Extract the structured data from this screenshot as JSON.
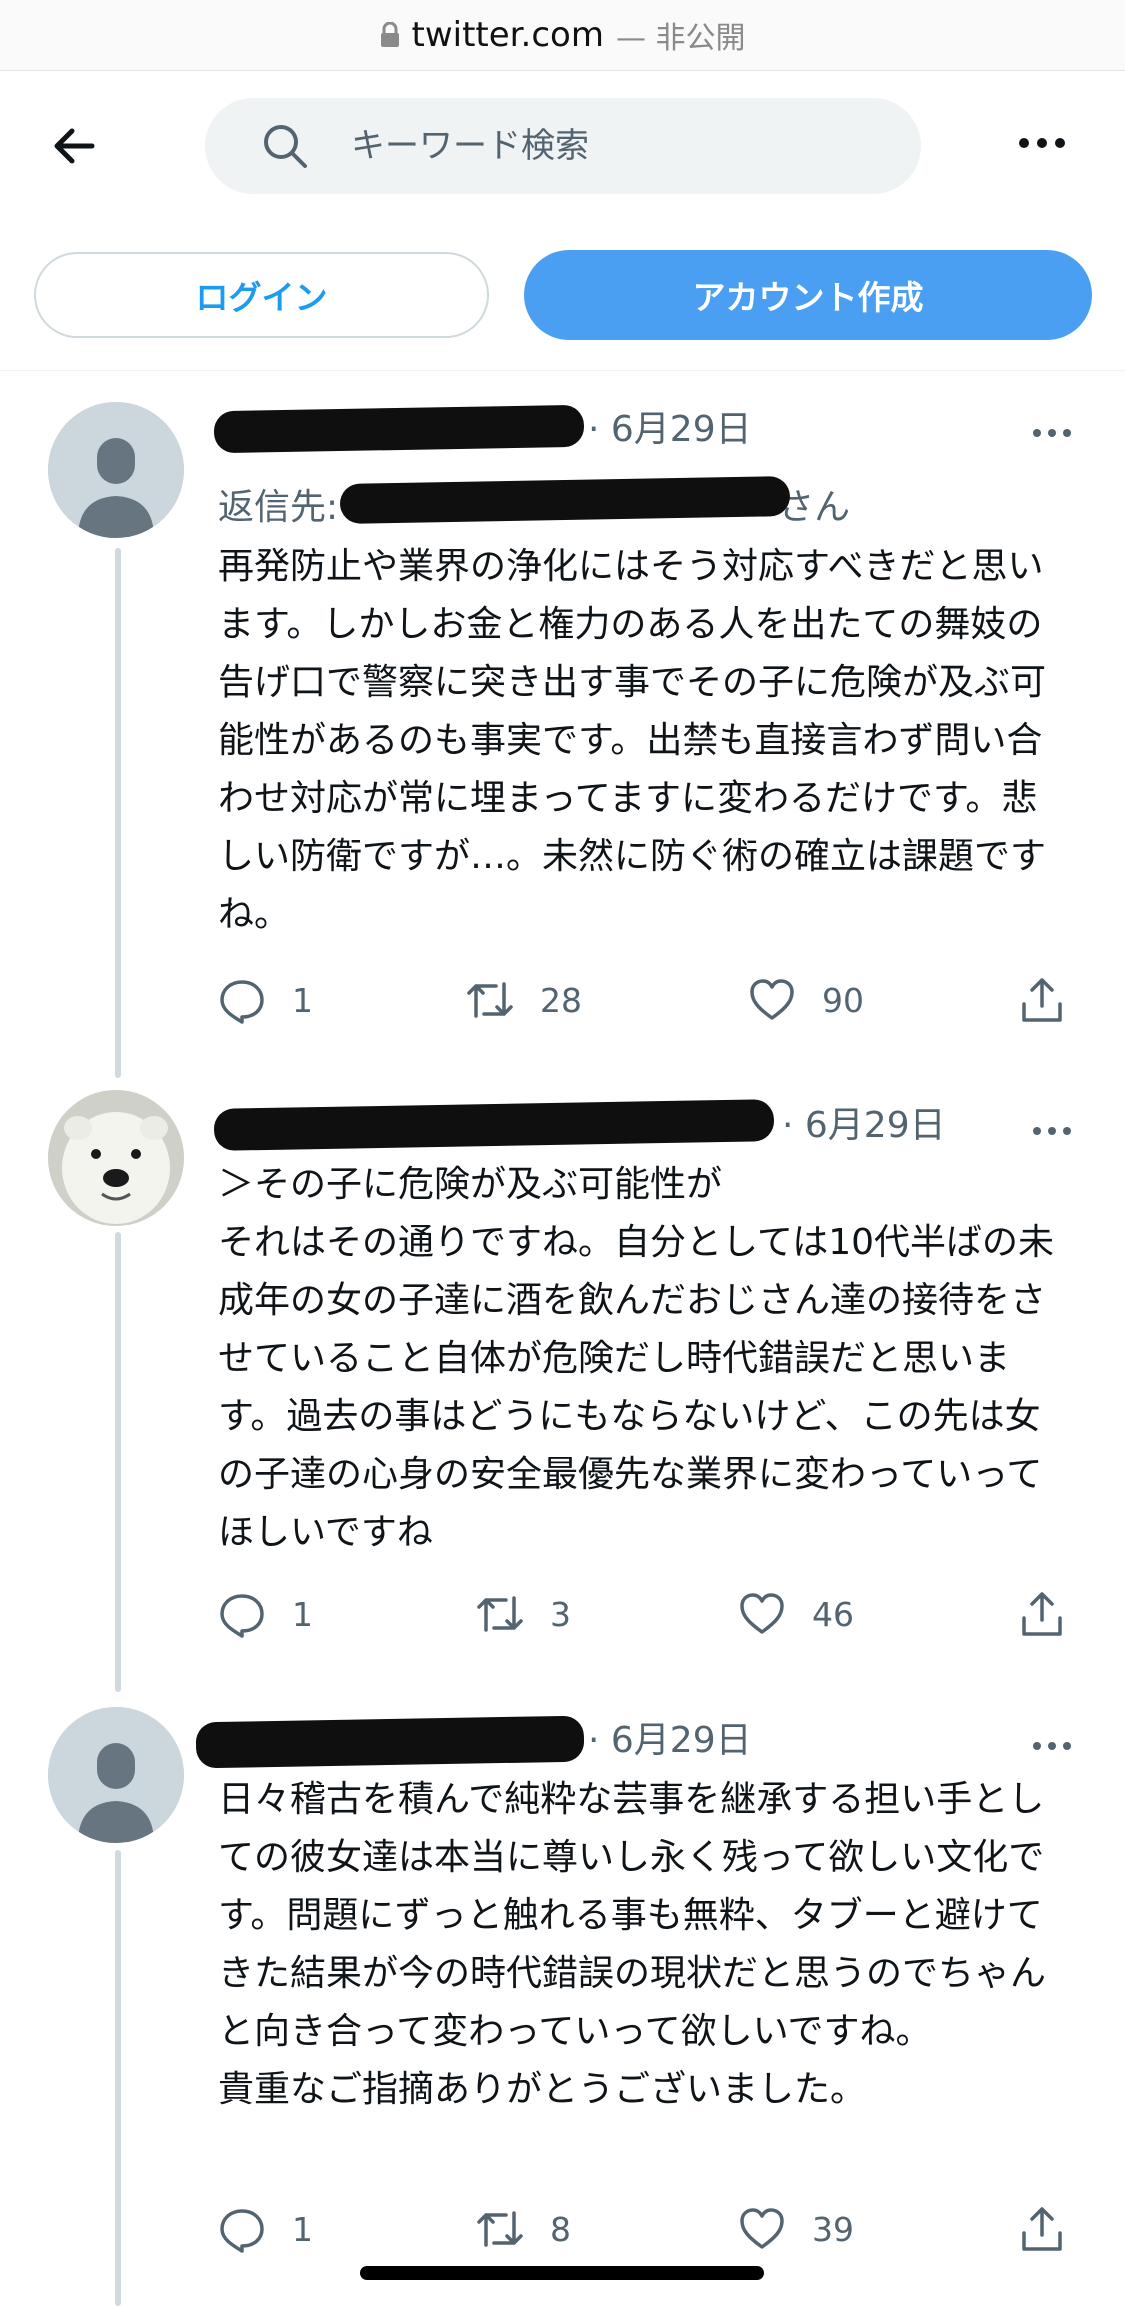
{
  "browser": {
    "url": "twitter.com",
    "privacy": "— 非公開"
  },
  "search": {
    "placeholder": "キーワード検索"
  },
  "auth": {
    "login_label": "ログイン",
    "signup_label": "アカウント作成"
  },
  "tweets": [
    {
      "date": "· 6月29日",
      "reply_prefix": "返信先:",
      "reply_suffix": "さん",
      "text": "再発防止や業界の浄化にはそう対応すべきだと思います。しかしお金と権力のある人を出たての舞妓の告げ口で警察に突き出す事でその子に危険が及ぶ可能性があるのも事実です。出禁も直接言わず問い合わせ対応が常に埋まってますに変わるだけです。悲しい防衛ですが…。未然に防ぐ術の確立は課題ですね。",
      "replies": "1",
      "retweets": "28",
      "likes": "90"
    },
    {
      "date": "· 6月29日",
      "text": "＞その子に危険が及ぶ可能性が\nそれはその通りですね。自分としては10代半ばの未成年の女の子達に酒を飲んだおじさん達の接待をさせていること自体が危険だし時代錯誤だと思います。過去の事はどうにもならないけど、この先は女の子達の心身の安全最優先な業界に変わっていってほしいですね",
      "replies": "1",
      "retweets": "3",
      "likes": "46"
    },
    {
      "date": "· 6月29日",
      "text": "日々稽古を積んで純粋な芸事を継承する担い手としての彼女達は本当に尊いし永く残って欲しい文化です。問題にずっと触れる事も無粋、タブーと避けてきた結果が今の時代錯誤の現状だと思うのでちゃんと向き合って変わっていって欲しいですね。\n貴重なご指摘ありがとうございました。",
      "replies": "1",
      "retweets": "8",
      "likes": "39"
    }
  ],
  "colors": {
    "accent": "#1d9bf0",
    "signup_bg": "#4a9ff2",
    "secondary_text": "#536471",
    "thread_line": "#cfd9de"
  },
  "icons": [
    "lock-icon",
    "back-arrow-icon",
    "search-icon",
    "more-icon",
    "reply-icon",
    "retweet-icon",
    "like-icon",
    "share-icon",
    "default-avatar-icon",
    "polar-bear-avatar"
  ]
}
